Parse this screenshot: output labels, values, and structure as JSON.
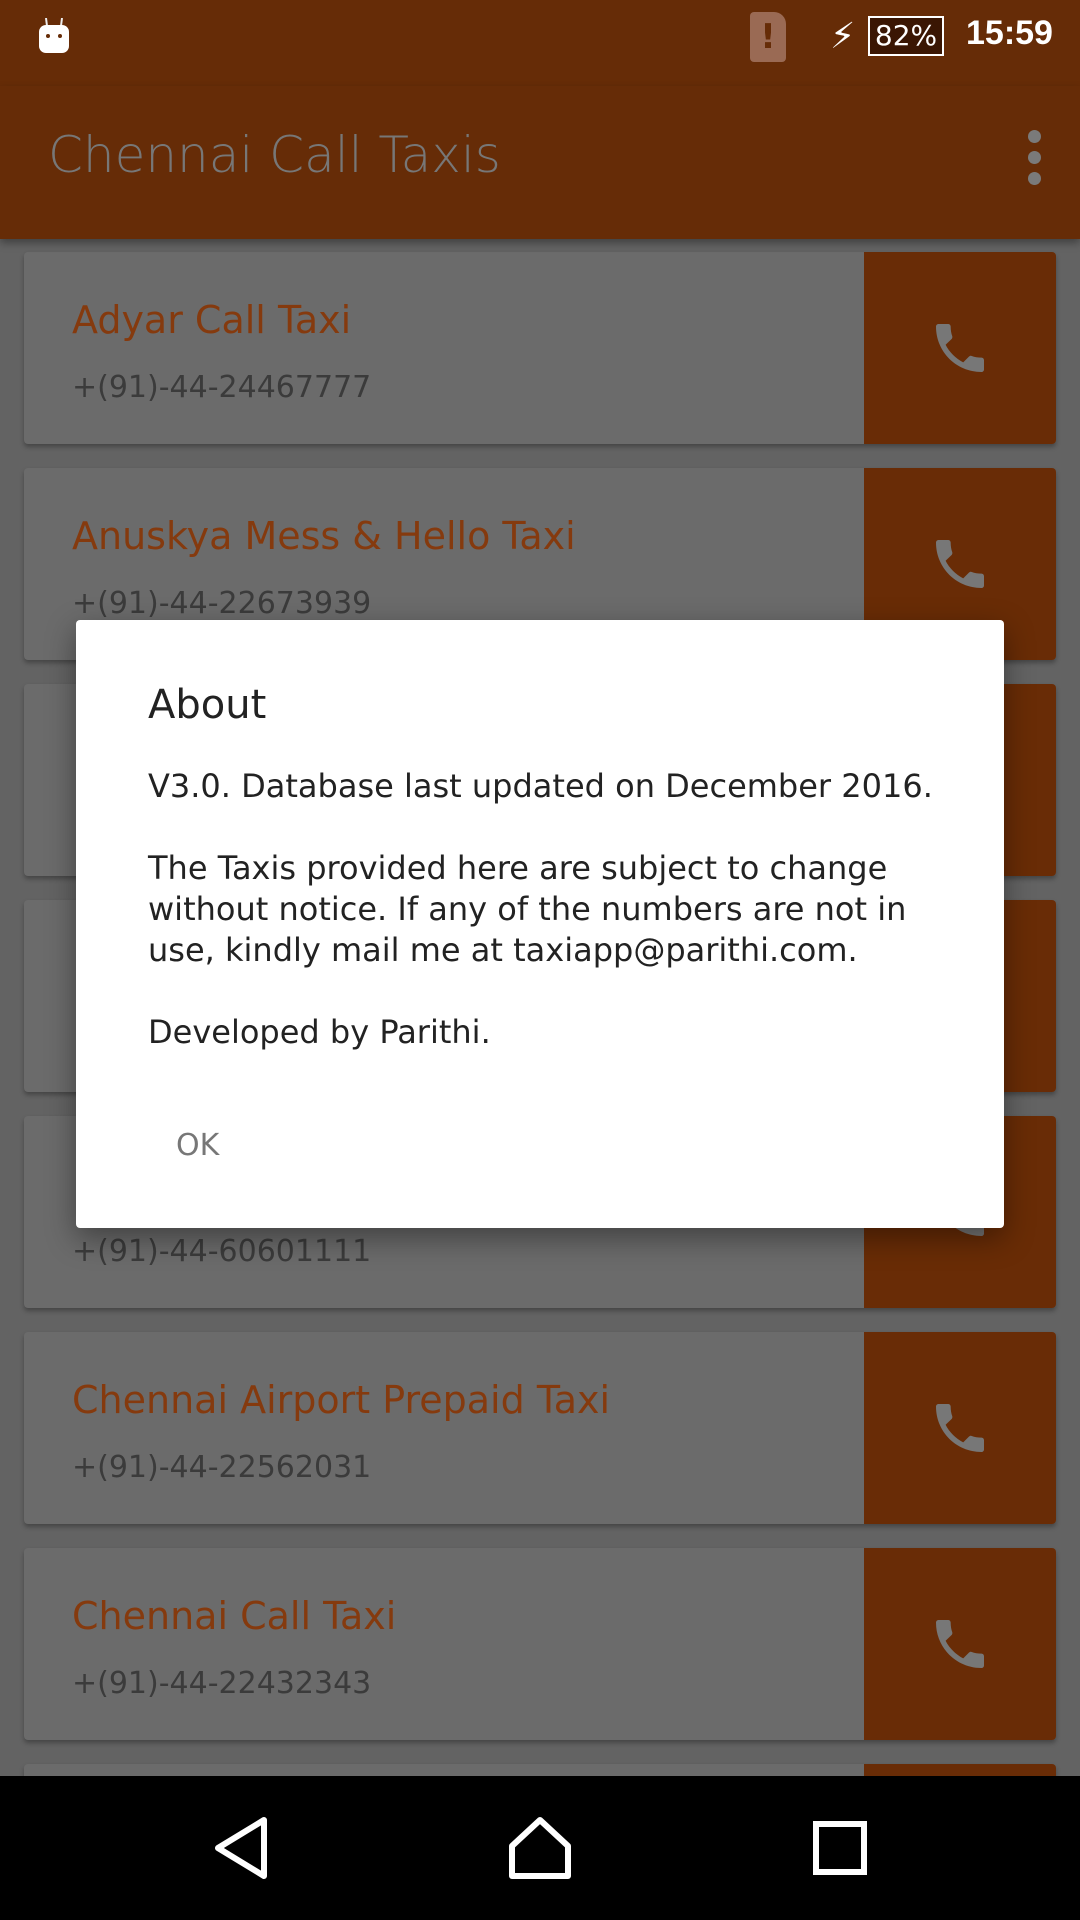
{
  "status_bar": {
    "battery": "82%",
    "time": "15:59",
    "icons": [
      "android-notification-icon",
      "sim-alert-icon",
      "charging-icon",
      "battery-icon"
    ]
  },
  "app_bar": {
    "title": "Chennai Call Taxis",
    "menu_icon": "overflow-menu-icon"
  },
  "colors": {
    "primary": "#662c07",
    "accent": "#853a0e"
  },
  "taxis": [
    {
      "name": "Adyar Call Taxi",
      "phone": "+(91)-44-24467777"
    },
    {
      "name": "Anuskya Mess & Hello Taxi",
      "phone": "+(91)-44-22673939"
    },
    {
      "name": "",
      "phone": ""
    },
    {
      "name": "",
      "phone": ""
    },
    {
      "name": "",
      "phone": "+(91)-44-60601111"
    },
    {
      "name": "Chennai Airport Prepaid Taxi",
      "phone": "+(91)-44-22562031"
    },
    {
      "name": "Chennai Call Taxi",
      "phone": "+(91)-44-22432343"
    },
    {
      "name": "",
      "phone": ""
    }
  ],
  "dialog": {
    "title": "About",
    "paragraphs": [
      "V3.0. Database last updated on December 2016.",
      "The Taxis provided here are subject to change without notice. If any of the numbers are not in use, kindly mail me at taxiapp@parithi.com.",
      "Developed by Parithi."
    ],
    "ok_label": "OK"
  }
}
